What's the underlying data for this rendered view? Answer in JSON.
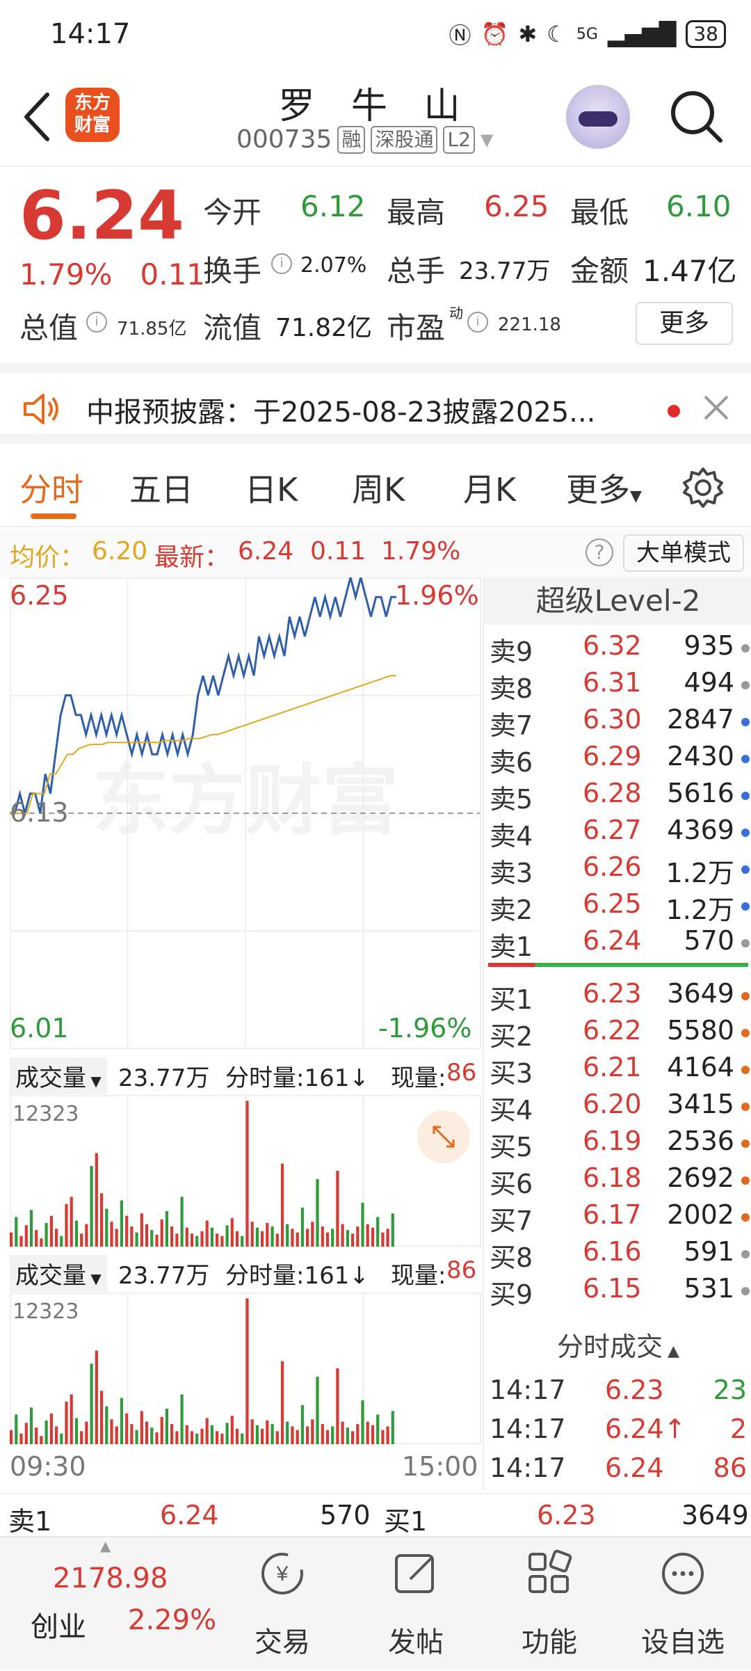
{
  "status": {
    "time": "14:17",
    "battery": "38",
    "network": "5G"
  },
  "header": {
    "title": "罗 牛 山",
    "code": "000735",
    "tags": [
      "融",
      "深股通",
      "L2"
    ],
    "logo_text": "东方财富"
  },
  "quote": {
    "price": "6.24",
    "change_pct": "1.79%",
    "change": "0.11",
    "open_label": "今开",
    "open": "6.12",
    "high_label": "最高",
    "high": "6.25",
    "low_label": "最低",
    "low": "6.10",
    "turnover_label": "换手",
    "turnover": "2.07%",
    "volume_label": "总手",
    "volume": "23.77万",
    "amount_label": "金额",
    "amount": "1.47亿",
    "mktcap_label": "总值",
    "mktcap": "71.85亿",
    "float_label": "流值",
    "float": "71.82亿",
    "pe_label": "市盈",
    "pe_sup": "动",
    "pe": "221.18",
    "more_button": "更多"
  },
  "notice": {
    "text": "中报预披露：于2025-08-23披露2025..."
  },
  "tabs": [
    "分时",
    "五日",
    "日K",
    "周K",
    "月K",
    "更多"
  ],
  "avgline": {
    "avg_label": "均价：",
    "avg": "6.20",
    "latest_label": "最新：",
    "latest": "6.24",
    "chg": "0.11",
    "pct": "1.79%",
    "bigorder_button": "大单模式"
  },
  "chart_data": {
    "type": "line",
    "title": "",
    "y_top": "6.25",
    "y_mid": "6.13",
    "y_bottom": "6.01",
    "pct_top": "1.96%",
    "pct_bottom": "-1.96%",
    "ylim": [
      6.01,
      6.25
    ],
    "x_start": "09:30",
    "x_end": "15:00",
    "watermark": "东方财富",
    "series": [
      {
        "values": [
          6.13,
          6.13,
          6.14,
          6.13,
          6.14,
          6.14,
          6.13,
          6.15,
          6.14,
          6.16,
          6.18,
          6.19,
          6.19,
          6.18,
          6.18,
          6.17,
          6.18,
          6.17,
          6.18,
          6.17,
          6.18,
          6.17,
          6.18,
          6.17,
          6.16,
          6.17,
          6.16,
          6.17,
          6.16,
          6.16,
          6.17,
          6.16,
          6.17,
          6.16,
          6.17,
          6.16,
          6.17,
          6.19,
          6.2,
          6.19,
          6.2,
          6.19,
          6.2,
          6.21,
          6.2,
          6.21,
          6.2,
          6.21,
          6.2,
          6.22,
          6.21,
          6.22,
          6.21,
          6.22,
          6.21,
          6.23,
          6.22,
          6.23,
          6.22,
          6.23,
          6.24,
          6.23,
          6.24,
          6.23,
          6.24,
          6.23,
          6.24,
          6.25,
          6.24,
          6.25,
          6.24,
          6.23,
          6.24,
          6.24,
          6.23,
          6.24,
          6.24
        ]
      },
      {
        "values": [
          6.13,
          6.13,
          6.13,
          6.13,
          6.14,
          6.14,
          6.14,
          6.15,
          6.15,
          6.155,
          6.16,
          6.16,
          6.163,
          6.164,
          6.165,
          6.165,
          6.165,
          6.166,
          6.166,
          6.166,
          6.166,
          6.166,
          6.166,
          6.166,
          6.166,
          6.166,
          6.166,
          6.167,
          6.167,
          6.167,
          6.167,
          6.168,
          6.168,
          6.168,
          6.169,
          6.17,
          6.17,
          6.171,
          6.172,
          6.173,
          6.174,
          6.175,
          6.176,
          6.177,
          6.178,
          6.179,
          6.18,
          6.181,
          6.182,
          6.183,
          6.184,
          6.185,
          6.186,
          6.187,
          6.188,
          6.189,
          6.19,
          6.191,
          6.192,
          6.193,
          6.194,
          6.195,
          6.196,
          6.197,
          6.198,
          6.199,
          6.2,
          6.2
        ]
      }
    ],
    "volume": {
      "label": "成交量",
      "total": "23.77万",
      "minute_label": "分时量:161↓",
      "now_label": "现量:",
      "now": "86",
      "ymax": "12323",
      "values": [
        1200,
        2500,
        900,
        1800,
        3100,
        1400,
        700,
        2000,
        2600,
        1500,
        900,
        3600,
        4200,
        2200,
        1100,
        1900,
        6800,
        7900,
        4500,
        3200,
        2100,
        1500,
        3900,
        2600,
        1700,
        1200,
        2800,
        1900,
        1400,
        1000,
        2300,
        3000,
        1700,
        1100,
        4200,
        1600,
        1100,
        900,
        1300,
        2200,
        1600,
        1100,
        900,
        1800,
        2400,
        1300,
        900,
        12300,
        2100,
        1600,
        1300,
        2000,
        1700,
        1100,
        7000,
        1900,
        1500,
        1200,
        3300,
        1500,
        2100,
        5700,
        1700,
        1200,
        1500,
        6400,
        1900,
        1400,
        1100,
        1700,
        3700,
        1900,
        1600,
        2500,
        1200,
        1500,
        2800
      ]
    }
  },
  "book": {
    "title": "超级Level-2",
    "sells": [
      {
        "label": "卖9",
        "price": "6.32",
        "vol": "935",
        "dot": "#999999"
      },
      {
        "label": "卖8",
        "price": "6.31",
        "vol": "494",
        "dot": "#999999"
      },
      {
        "label": "卖7",
        "price": "6.30",
        "vol": "2847",
        "dot": "#3a6fd8"
      },
      {
        "label": "卖6",
        "price": "6.29",
        "vol": "2430",
        "dot": "#3a6fd8"
      },
      {
        "label": "卖5",
        "price": "6.28",
        "vol": "5616",
        "dot": "#3a6fd8"
      },
      {
        "label": "卖4",
        "price": "6.27",
        "vol": "4369",
        "dot": "#3a6fd8"
      },
      {
        "label": "卖3",
        "price": "6.26",
        "vol": "1.2万",
        "dot": "#3a6fd8"
      },
      {
        "label": "卖2",
        "price": "6.25",
        "vol": "1.2万",
        "dot": "#3a6fd8"
      },
      {
        "label": "卖1",
        "price": "6.24",
        "vol": "570",
        "dot": "#999999"
      }
    ],
    "buys": [
      {
        "label": "买1",
        "price": "6.23",
        "vol": "3649",
        "dot": "#e06a20"
      },
      {
        "label": "买2",
        "price": "6.22",
        "vol": "5580",
        "dot": "#e06a20"
      },
      {
        "label": "买3",
        "price": "6.21",
        "vol": "4164",
        "dot": "#e06a20"
      },
      {
        "label": "买4",
        "price": "6.20",
        "vol": "3415",
        "dot": "#e06a20"
      },
      {
        "label": "买5",
        "price": "6.19",
        "vol": "2536",
        "dot": "#e06a20"
      },
      {
        "label": "买6",
        "price": "6.18",
        "vol": "2692",
        "dot": "#e06a20"
      },
      {
        "label": "买7",
        "price": "6.17",
        "vol": "2002",
        "dot": "#e06a20"
      },
      {
        "label": "买8",
        "price": "6.16",
        "vol": "591",
        "dot": "#999999"
      },
      {
        "label": "买9",
        "price": "6.15",
        "vol": "531",
        "dot": "#999999"
      }
    ],
    "ticks_title": "分时成交",
    "ticks": [
      {
        "time": "14:17",
        "price": "6.23",
        "vol": "23"
      },
      {
        "time": "14:17",
        "price": "6.24↑",
        "vol": "2"
      },
      {
        "time": "14:17",
        "price": "6.24",
        "vol": "86"
      }
    ]
  },
  "bottomquote": {
    "sell_label": "卖1",
    "sell_price": "6.24",
    "sell_vol": "570",
    "buy_label": "买1",
    "buy_price": "6.23",
    "buy_vol": "3649"
  },
  "bottomnav": {
    "index_value": "2178.98",
    "index_name": "创业",
    "index_pct": "2.29%",
    "items": [
      "交易",
      "发帖",
      "功能",
      "设自选"
    ]
  },
  "colors": {
    "up": "#d63a32",
    "down": "#2e9a3a",
    "accent": "#e56a1c",
    "avg_line": "#e0a820",
    "price_line": "#2e5fa8"
  }
}
